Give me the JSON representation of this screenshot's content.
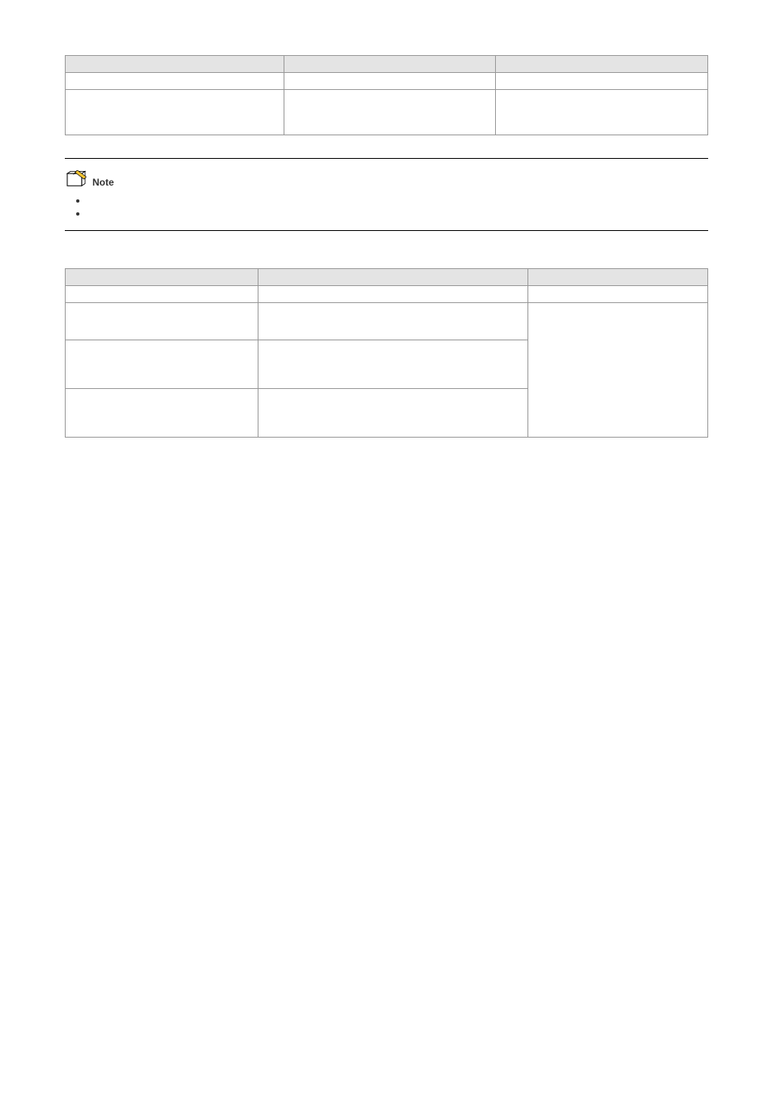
{
  "table1": {
    "headers": [
      "",
      "",
      ""
    ],
    "rows": [
      {
        "c1": "",
        "c2": "",
        "c3": ""
      },
      {
        "c1": "",
        "c2": "",
        "c3": ""
      }
    ]
  },
  "note": {
    "label": "Note",
    "items": [
      "",
      ""
    ]
  },
  "table2": {
    "headers": [
      "",
      "",
      ""
    ],
    "rows": [
      {
        "c1": "",
        "c2": "",
        "c3": ""
      },
      {
        "c1": "",
        "c2": "",
        "c3": ""
      },
      {
        "c1": "",
        "c2": "",
        "c3": ""
      },
      {
        "c1": "",
        "c2": "",
        "c3": ""
      }
    ]
  }
}
